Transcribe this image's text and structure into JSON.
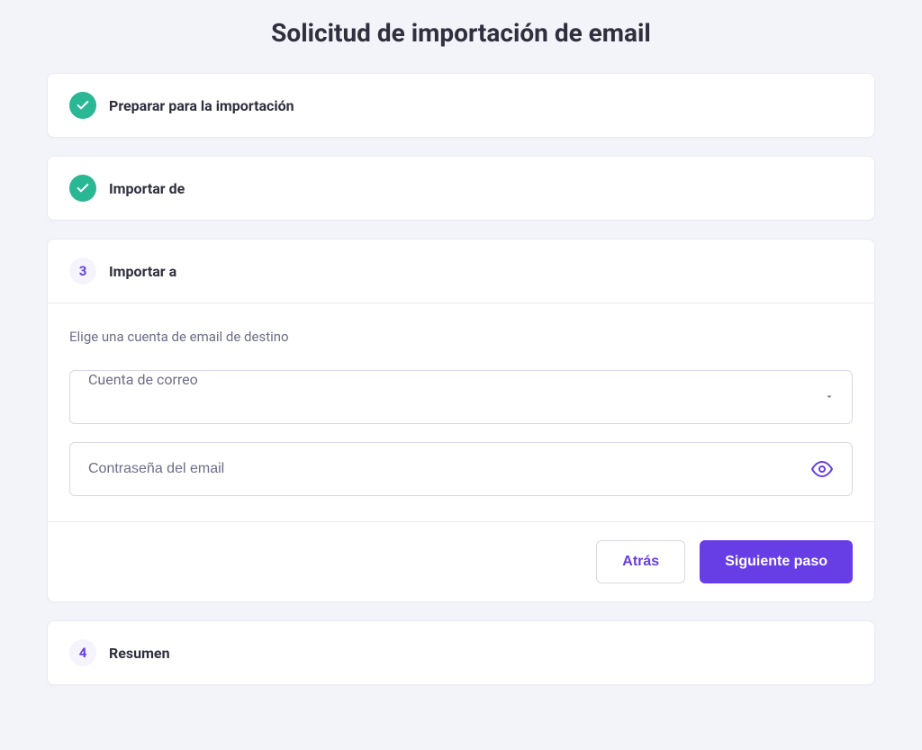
{
  "page_title": "Solicitud de importación de email",
  "steps": {
    "step1": {
      "title": "Preparar para la importación"
    },
    "step2": {
      "title": "Importar de"
    },
    "step3": {
      "number": "3",
      "title": "Importar a",
      "description": "Elige una cuenta de email de destino",
      "account_select_placeholder": "Cuenta de correo",
      "password_placeholder": "Contraseña del email",
      "back_button": "Atrás",
      "next_button": "Siguiente paso"
    },
    "step4": {
      "number": "4",
      "title": "Resumen"
    }
  }
}
